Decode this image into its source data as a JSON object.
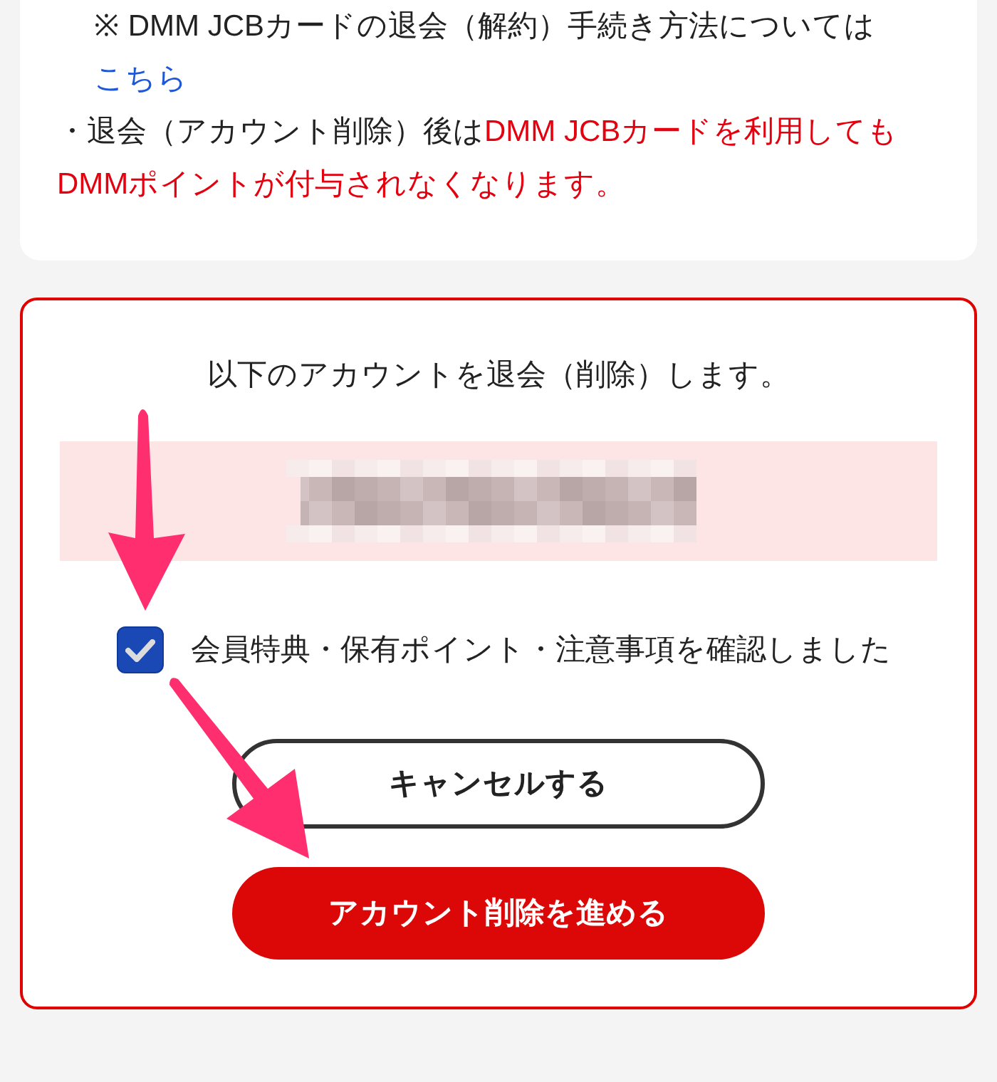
{
  "info_card": {
    "notes": [
      {
        "kind": "sub_note",
        "segments": [
          {
            "kind": "plain",
            "text": "※ DMM JCBカードの退会（解約）手続き方法については"
          },
          {
            "kind": "link",
            "text": "こちら"
          }
        ]
      },
      {
        "kind": "bullet",
        "segments": [
          {
            "kind": "plain",
            "text": "・退会（アカウント削除）後は"
          },
          {
            "kind": "warning",
            "text": "DMM JCBカードを利用してもDMMポイントが付与されなくなります。"
          }
        ]
      }
    ]
  },
  "confirm_card": {
    "heading": "以下のアカウントを退会（削除）します。",
    "checkbox": {
      "label": "会員特典・保有ポイント・注意事項を確認しました",
      "checked": true
    },
    "buttons": [
      {
        "kind": "secondary",
        "label": "キャンセルする"
      },
      {
        "kind": "primary",
        "label": "アカウント削除を進める"
      }
    ]
  }
}
